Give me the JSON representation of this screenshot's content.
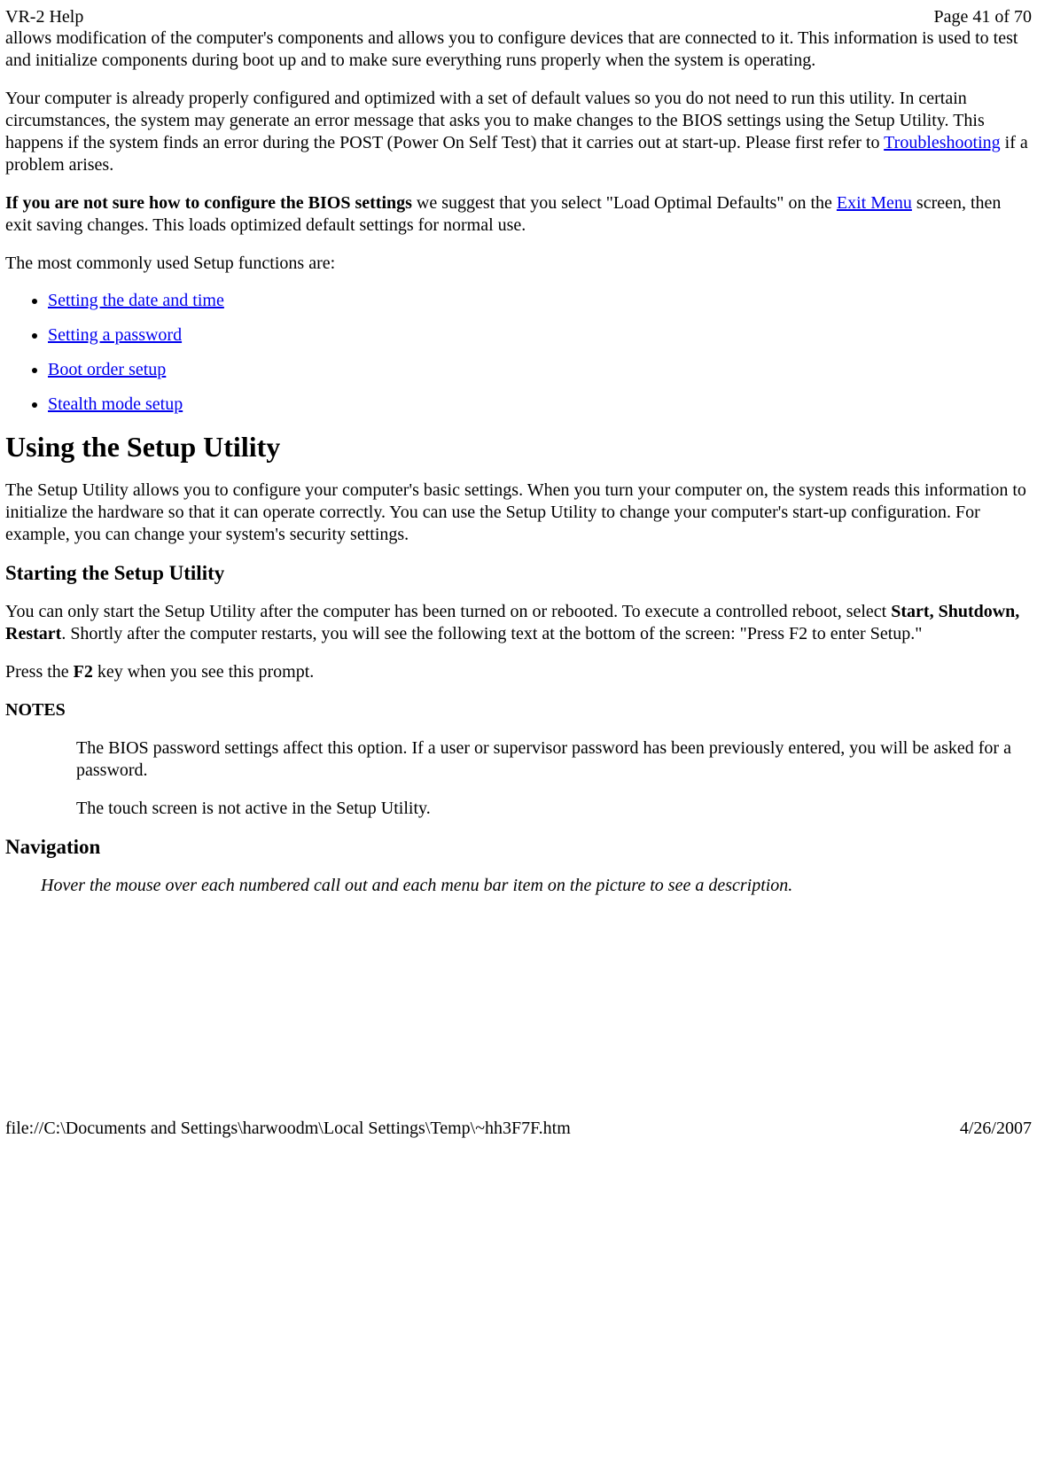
{
  "header": {
    "left": "VR-2 Help",
    "right": "Page 41 of 70"
  },
  "para1_a": "allows modification of the computer's components and allows you to configure devices that are connected to it. This information is used to test and initialize components during boot up and to make sure everything runs properly when the system is operating.",
  "para2_a": "Your computer is already properly configured and optimized with a set of default values so you do not need to run this utility. In certain circumstances, the system may generate an error message that asks you to make changes to the BIOS settings using the Setup Utility. This happens if the system finds an error during the POST (Power On Self Test) that it carries out at start-up. Please first refer to ",
  "para2_link": "Troubleshooting",
  "para2_b": " if a problem arises.",
  "para3_bold": "If you are not sure how to configure the BIOS settings",
  "para3_a": " we suggest that you select \"Load Optimal Defaults\" on the ",
  "para3_link": "Exit Menu",
  "para3_b": " screen, then exit saving changes.  This loads optimized default settings for normal use.",
  "para4": "The most commonly used Setup functions are:",
  "list": {
    "0": "Setting the date and time",
    "1": "Setting a password",
    "2": "Boot order setup",
    "3": "Stealth mode setup"
  },
  "h2_using": "Using the Setup Utility",
  "para5": "The Setup Utility allows you to configure your computer's basic settings. When you turn your computer on, the system reads this information to initialize the hardware so that it can operate correctly. You can use the Setup Utility to change your computer's start-up configuration. For example, you can change your system's security settings.",
  "h3_starting": "Starting the Setup Utility",
  "para6_a": "You can only start the Setup Utility after the computer has been turned on or rebooted. To execute a controlled reboot, select ",
  "para6_bold": "Start, Shutdown, Restart",
  "para6_b": ". Shortly after the computer restarts, you will see the following text at the bottom of the screen: \"Press F2 to enter Setup.\"",
  "para7_a": "Press the ",
  "para7_bold": "F2",
  "para7_b": " key when you see this prompt.",
  "notes_label": "NOTES",
  "note1": "The BIOS password settings affect this option. If a user or supervisor password has been previously entered, you will be asked for a password.",
  "note2": "The touch screen is not active in the Setup Utility.",
  "h3_nav": "Navigation",
  "nav_hint": "Hover the mouse over each numbered call out and each menu bar item on the picture to see a description.",
  "footer": {
    "left": "file://C:\\Documents and Settings\\harwoodm\\Local Settings\\Temp\\~hh3F7F.htm",
    "right": "4/26/2007"
  }
}
